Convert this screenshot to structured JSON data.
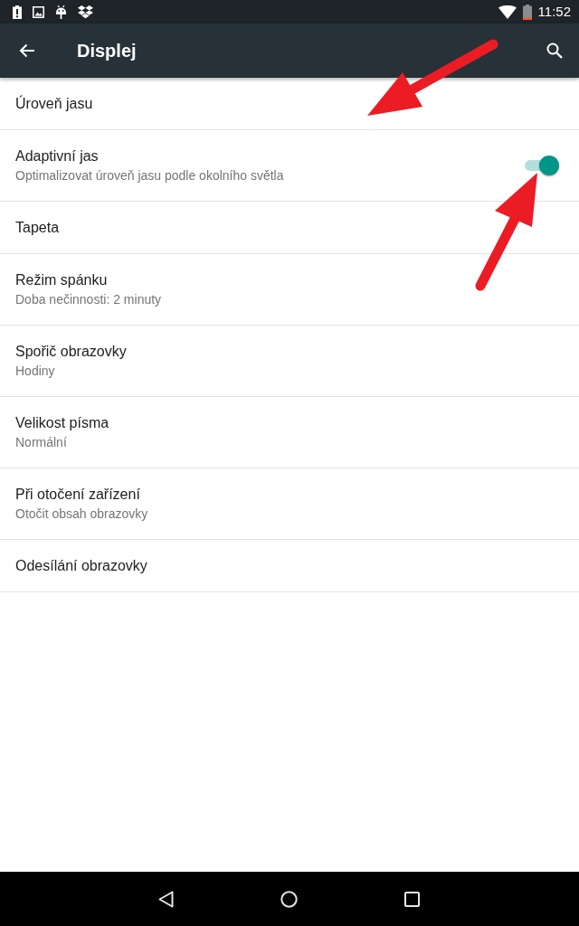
{
  "status_bar": {
    "time": "11:52"
  },
  "app_bar": {
    "title": "Displej"
  },
  "settings": [
    {
      "kind": "plain",
      "title": "Úroveň jasu"
    },
    {
      "kind": "switch",
      "title": "Adaptivní jas",
      "summary": "Optimalizovat úroveň jasu podle okolního světla",
      "on": true
    },
    {
      "kind": "plain",
      "title": "Tapeta"
    },
    {
      "kind": "plain",
      "title": "Režim spánku",
      "summary": "Doba nečinnosti: 2 minuty"
    },
    {
      "kind": "plain",
      "title": "Spořič obrazovky",
      "summary": "Hodiny"
    },
    {
      "kind": "plain",
      "title": "Velikost písma",
      "summary": "Normální"
    },
    {
      "kind": "plain",
      "title": "Při otočení zařízení",
      "summary": "Otočit obsah obrazovky"
    },
    {
      "kind": "plain",
      "title": "Odesílání obrazovky"
    }
  ]
}
